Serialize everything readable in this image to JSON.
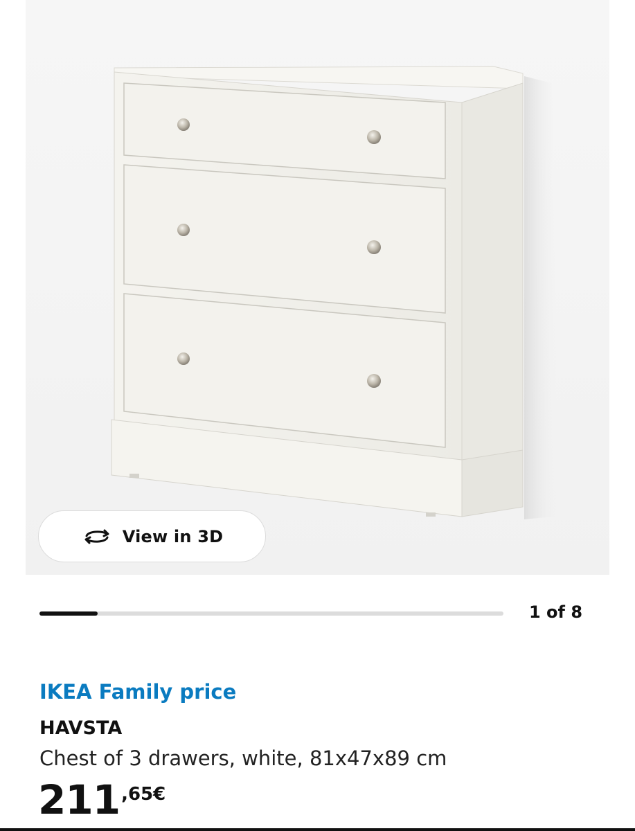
{
  "media": {
    "image_alt": "HAVSTA chest of 3 drawers, white",
    "view_3d_label": "View in 3D",
    "view_3d_icon": "rotate-3d-icon"
  },
  "gallery": {
    "counter": "1 of 8",
    "progress_fraction": 0.125
  },
  "product": {
    "price_label": "IKEA Family price",
    "name": "HAVSTA",
    "description": "Chest of 3 drawers, white, 81x47x89 cm",
    "price_integer": "211",
    "price_decimal": ",65€"
  },
  "colors": {
    "family_blue": "#0a7bc0",
    "text": "#111111",
    "track": "#dcdcdc"
  }
}
